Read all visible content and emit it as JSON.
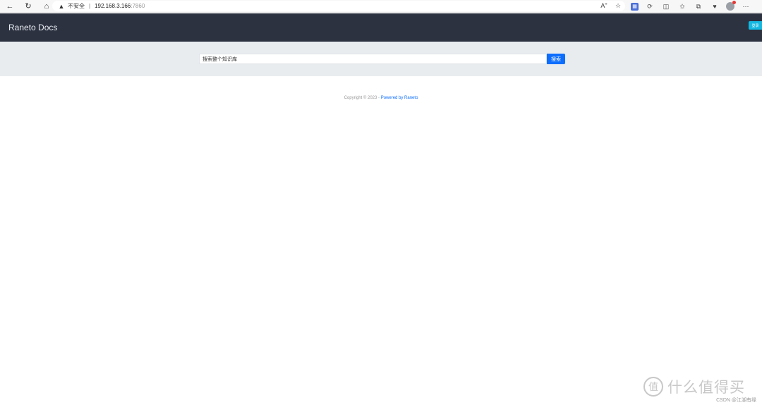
{
  "browser": {
    "insecure_label": "不安全",
    "separator": "|",
    "url_host": "192.168.3.166",
    "url_port": ":7860",
    "icons": {
      "back": "back-arrow-icon",
      "reload": "reload-icon",
      "home": "home-icon",
      "warning": "warning-icon",
      "read_aloud": "read-aloud-icon",
      "favorite": "star-icon"
    },
    "read_aloud_glyph": "Aʺ",
    "toolbar_icons": [
      "extension-icon",
      "refresh-extension-icon",
      "split-screen-icon",
      "favorites-icon",
      "collections-icon",
      "browser-essentials-icon",
      "profile-avatar-icon",
      "more-options-icon"
    ]
  },
  "navbar": {
    "brand": "Raneto Docs",
    "login_label": "登录"
  },
  "search": {
    "placeholder": "搜索整个知识库",
    "button_label": "搜索"
  },
  "footer": {
    "copyright": "Copyright © 2023 - ",
    "powered": "Powered by Raneto"
  },
  "watermark": {
    "logo_glyph": "值",
    "text": "什么值得买",
    "credit": "CSDN @江湖有缘"
  },
  "colors": {
    "navbar_bg": "#2c3240",
    "search_band_bg": "#e9ecef",
    "primary": "#0d6efd",
    "login_bg": "#14b8e0"
  }
}
